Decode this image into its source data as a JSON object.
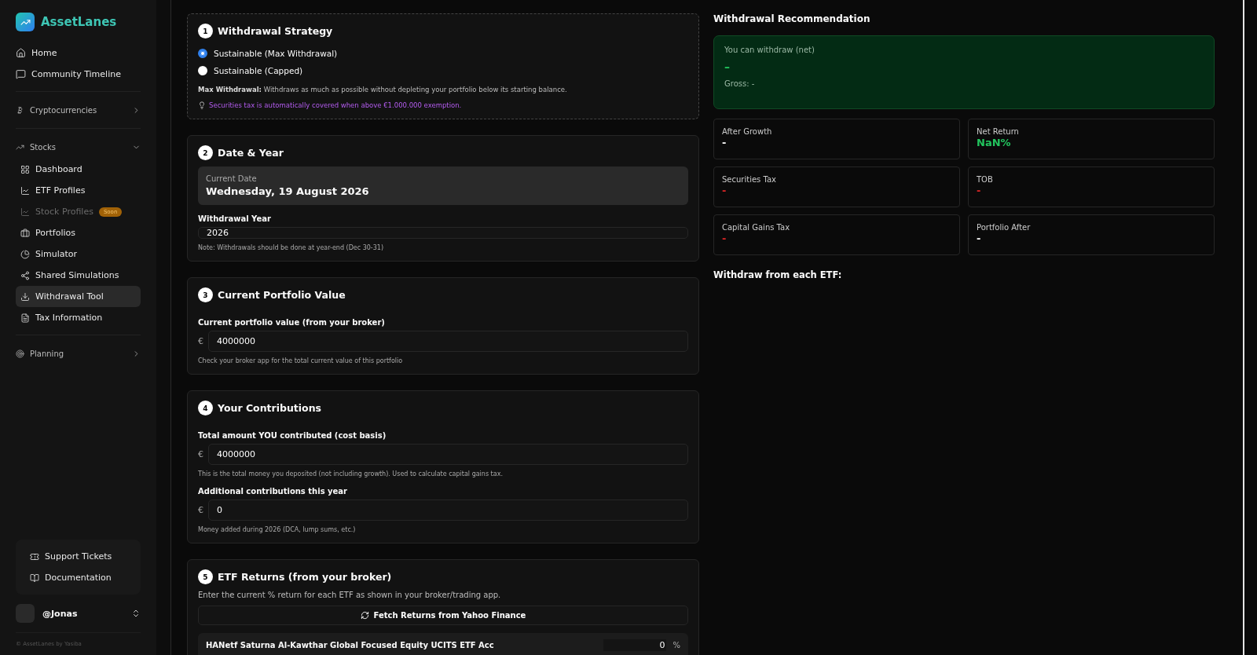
{
  "sidebar": {
    "brand": "AssetLanes",
    "top_items": [
      {
        "label": "Home",
        "selected": false
      },
      {
        "label": "Community Timeline",
        "selected": false
      }
    ],
    "groups": [
      {
        "label": "Cryptocurrencies",
        "expanded": false
      },
      {
        "label": "Stocks",
        "expanded": true,
        "children": [
          {
            "label": "Dashboard",
            "selected": false,
            "disabled": false
          },
          {
            "label": "ETF Profiles",
            "selected": false,
            "disabled": false
          },
          {
            "label": "Stock Profiles",
            "selected": false,
            "disabled": true,
            "badge": "Soon"
          },
          {
            "label": "Portfolios",
            "selected": false,
            "disabled": false
          },
          {
            "label": "Simulator",
            "selected": false,
            "disabled": false
          },
          {
            "label": "Shared Simulations",
            "selected": false,
            "disabled": false
          },
          {
            "label": "Withdrawal Tool",
            "selected": true,
            "disabled": false
          },
          {
            "label": "Tax Information",
            "selected": false,
            "disabled": false
          }
        ]
      },
      {
        "label": "Planning",
        "expanded": false
      }
    ],
    "help_items": [
      "Support Tickets",
      "Documentation"
    ],
    "user": "@Jonas",
    "footer": "© AssetLanes by Yasiba"
  },
  "strategy": {
    "number": "1",
    "title": "Withdrawal Strategy",
    "options": [
      {
        "label": "Sustainable (Max Withdrawal)",
        "selected": true
      },
      {
        "label": "Sustainable (Capped)",
        "selected": false
      }
    ],
    "description": "**Max Withdrawal:** Withdraws as much as possible without depleting your portfolio below its starting balance.",
    "tip": "Securities tax is automatically covered when above €1.000.000 exemption."
  },
  "date_year": {
    "number": "2",
    "title": "Date & Year",
    "current_date_label": "Current Date",
    "current_date": "Wednesday, 19 August 2026",
    "year_label": "Withdrawal Year",
    "year_value": "2026",
    "note": "Note: Withdrawals should be done at year-end (Dec 30-31)"
  },
  "portfolio": {
    "number": "3",
    "title": "Current Portfolio Value",
    "fields": [
      {
        "label": "Current portfolio value (from your broker)",
        "currency": "€",
        "value": "4000000",
        "hint": "Check your broker app for the total current value of this portfolio"
      }
    ]
  },
  "contributions": {
    "number": "4",
    "title": "Your Contributions",
    "fields": [
      {
        "label": "Total amount YOU contributed (cost basis)",
        "currency": "€",
        "value": "4000000",
        "hint": "This is the total money you deposited (not including growth). Used to calculate capital gains tax."
      },
      {
        "label": "Additional contributions this year",
        "currency": "€",
        "value": "0",
        "hint": "Money added during 2026 (DCA, lump sums, etc.)"
      }
    ]
  },
  "etf_returns": {
    "number": "5",
    "title": "ETF Returns (from your broker)",
    "description": "Enter the current % return for each ETF as shown in your broker/trading app.",
    "fetch_button": "Fetch Returns from Yahoo Finance",
    "etfs": [
      {
        "name": "HANetf Saturna Al-Kawthar Global Focused Equity UCITS ETF Acc",
        "value": "0",
        "unit": "%"
      }
    ]
  },
  "recommendation": {
    "title": "Withdrawal Recommendation",
    "net_label": "You can withdraw (net)",
    "net_value": "–",
    "gross": "Gross: -",
    "stats": [
      {
        "label": "After Growth",
        "value": "-",
        "color": "#ffffff"
      },
      {
        "label": "Net Return",
        "value": "NaN%",
        "color": "#22c55e"
      },
      {
        "label": "Securities Tax",
        "value": "-",
        "color": "#dc2626"
      },
      {
        "label": "TOB",
        "value": "-",
        "color": "#dc2626"
      },
      {
        "label": "Capital Gains Tax",
        "value": "-",
        "color": "#dc2626"
      },
      {
        "label": "Portfolio After",
        "value": "-",
        "color": "#ffffff"
      }
    ],
    "per_etf_title": "Withdraw from each ETF:"
  }
}
